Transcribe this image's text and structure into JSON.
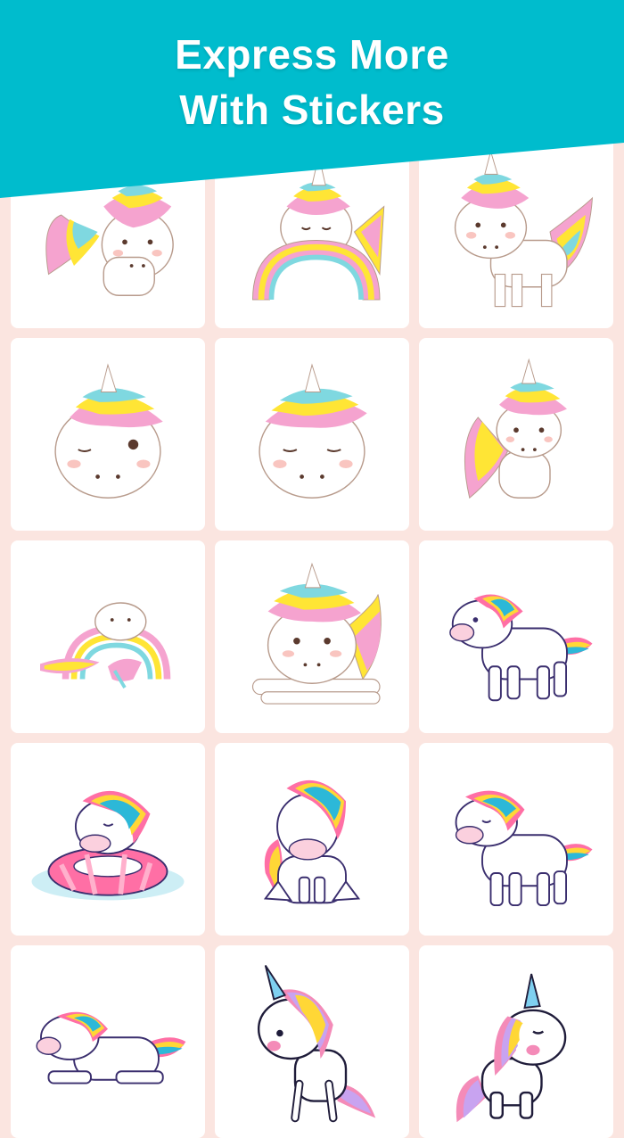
{
  "header": {
    "line1": "Express More",
    "line2": "With Stickers",
    "background_color": "#00bccd"
  },
  "stickers": [
    {
      "icon": "winged-unicorn-sitting-icon"
    },
    {
      "icon": "unicorn-sleeping-on-rainbow-icon"
    },
    {
      "icon": "winged-unicorn-standing-icon"
    },
    {
      "icon": "unicorn-face-winking-icon"
    },
    {
      "icon": "unicorn-face-sleepy-icon"
    },
    {
      "icon": "winged-unicorn-small-icon"
    },
    {
      "icon": "unicorn-lying-rainbow-icon"
    },
    {
      "icon": "unicorn-lying-down-icon"
    },
    {
      "icon": "pony-walking-icon"
    },
    {
      "icon": "pony-swim-ring-icon"
    },
    {
      "icon": "pony-sitting-icon"
    },
    {
      "icon": "pony-walking-eyes-closed-icon"
    },
    {
      "icon": "pony-lying-icon"
    },
    {
      "icon": "unicorn-rearing-icon"
    },
    {
      "icon": "unicorn-standing-icon"
    }
  ]
}
